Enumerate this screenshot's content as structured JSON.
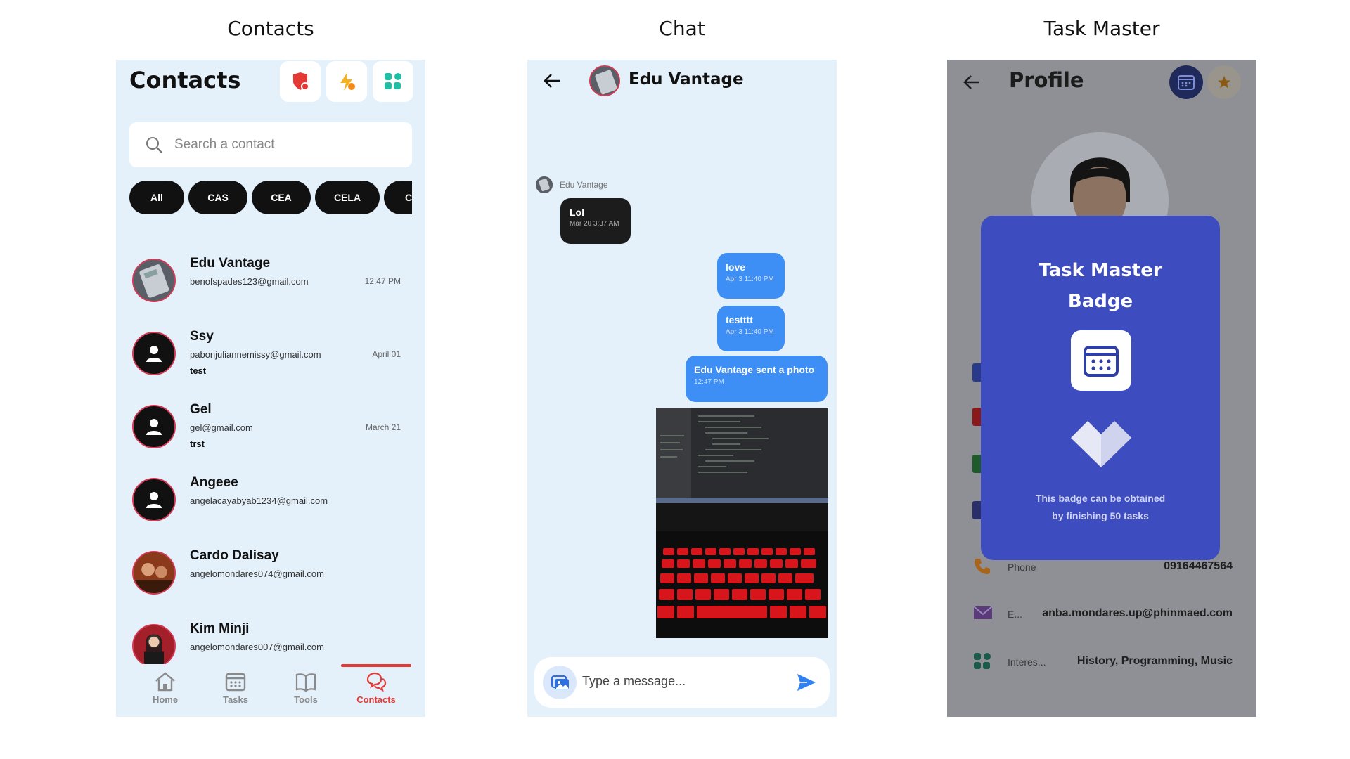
{
  "sections": {
    "contacts": "Contacts",
    "chat": "Chat",
    "task_master": "Task Master"
  },
  "contacts_screen": {
    "title": "Contacts",
    "search_placeholder": "Search a contact",
    "filters": [
      "All",
      "CAS",
      "CEA",
      "CELA",
      "C"
    ],
    "items": [
      {
        "name": "Edu Vantage",
        "email": "benofspades123@gmail.com",
        "message": "",
        "time": "12:47 PM"
      },
      {
        "name": "Ssy",
        "email": "pabonjuliannemissy@gmail.com",
        "message": "test",
        "time": "April 01"
      },
      {
        "name": "Gel",
        "email": "gel@gmail.com",
        "message": "trst",
        "time": "March 21"
      },
      {
        "name": "Angeee",
        "email": "angelacayabyab1234@gmail.com",
        "message": "",
        "time": ""
      },
      {
        "name": "Cardo Dalisay",
        "email": "angelomondares074@gmail.com",
        "message": "",
        "time": ""
      },
      {
        "name": "Kim Minji",
        "email": "angelomondares007@gmail.com",
        "message": "",
        "time": ""
      }
    ],
    "nav": [
      {
        "label": "Home",
        "icon": "home-icon"
      },
      {
        "label": "Tasks",
        "icon": "calendar-icon"
      },
      {
        "label": "Tools",
        "icon": "book-icon"
      },
      {
        "label": "Contacts",
        "icon": "chat-icon",
        "active": true
      }
    ],
    "colors": {
      "background": "#e4f1fb",
      "accent": "#e53935"
    }
  },
  "chat_screen": {
    "contact_name": "Edu Vantage",
    "sender_label": "Edu Vantage",
    "incoming": {
      "text": "Lol",
      "time": "Mar 20 3:37 AM"
    },
    "outgoing": [
      {
        "text": "love",
        "time": "Apr 3 11:40 PM"
      },
      {
        "text": "testttt",
        "time": "Apr 3 11:40 PM"
      },
      {
        "text": "Edu Vantage sent a photo",
        "time": "12:47 PM"
      }
    ],
    "composer_placeholder": "Type a message...",
    "colors": {
      "outgoing_bubble": "#3d8ef5",
      "incoming_bubble": "#1c1c1c"
    }
  },
  "profile_screen": {
    "title": "Profile",
    "fields": [
      {
        "label": "Phone",
        "value": "09164467564",
        "icon": "phone-icon"
      },
      {
        "label": "E...",
        "value": "anba.mondares.up@phinmaed.com",
        "icon": "mail-icon"
      },
      {
        "label": "Interes...",
        "value": "History, Programming, Music",
        "icon": "interests-icon"
      }
    ],
    "badge": {
      "title_line1": "Task Master",
      "title_line2": "Badge",
      "desc_line1": "This badge can be obtained",
      "desc_line2": "by finishing 50 tasks"
    },
    "colors": {
      "modal": "#3d4cbf",
      "overlay": "#8e9096"
    }
  }
}
